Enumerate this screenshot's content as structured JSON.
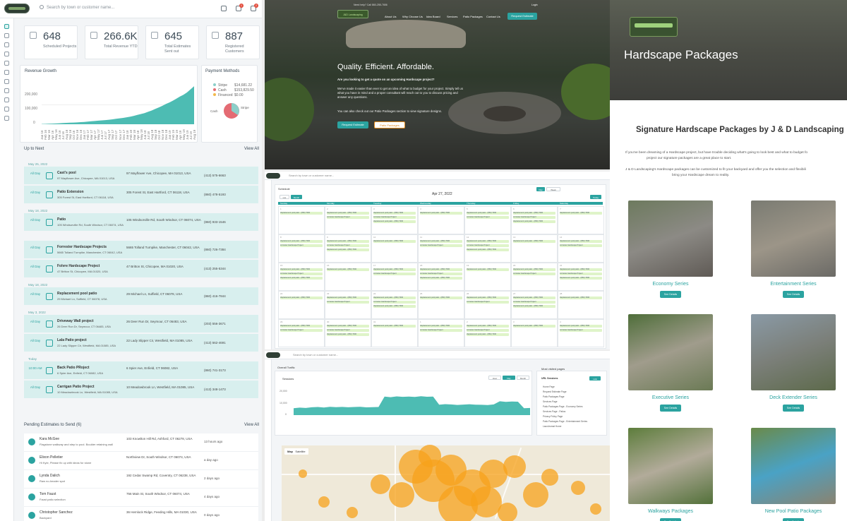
{
  "dash": {
    "search_placeholder": "Search by town or customer name...",
    "notif_count": "1",
    "msg_count": "2",
    "stats": [
      {
        "value": "648",
        "label": "Scheduled Projects"
      },
      {
        "value": "266.6K",
        "label": "Total Revenue YTD"
      },
      {
        "value": "645",
        "label": "Total Estimates Sent out"
      },
      {
        "value": "887",
        "label": "Registered Customers"
      }
    ],
    "revenue": {
      "title": "Revenue Growth",
      "y_ticks": [
        "200,000",
        "100,000",
        "0"
      ]
    },
    "payments": {
      "title": "Payment Methods",
      "items": [
        {
          "name": "Stripe",
          "amount": "$14,681.22",
          "color": "#8ccfc9"
        },
        {
          "name": "Cash",
          "amount": "$153,829.50",
          "color": "#e46b73"
        },
        {
          "name": "Financed",
          "amount": "$0.00",
          "color": "#f2b84b"
        }
      ],
      "label_cash": "Cash",
      "label_stripe": "Stripe"
    },
    "up_next": {
      "title": "Up to Next",
      "view_all": "View All",
      "groups": [
        {
          "date": "May 25, 2022",
          "rows": [
            {
              "time": "All Day",
              "name": "Cast's pool",
              "addr": "97 Mayflower Ave, Chicopee, MA 01013, USA",
              "addr2": "97 Mayflower Ave, Chicopee, MA 01013, USA",
              "phone": "(413) 575-6663"
            },
            {
              "time": "All Day",
              "name": "Patio Extension",
              "addr": "305 Forest St, East Hartford, CT 06118, USA",
              "addr2": "305 Forest St, East Hartford, CT 06118, USA",
              "phone": "(860) 478-5193"
            }
          ]
        },
        {
          "date": "May 18, 2022",
          "rows": [
            {
              "time": "All Day",
              "name": "Patio",
              "addr": "105 Windsorville Rd, South Windsor, CT 06074, USA",
              "addr2": "105 Windsorville Rd, South Windsor, CT 06074, USA",
              "phone": "(860) 933-1546"
            }
          ]
        },
        {
          "date": "",
          "rows": [
            {
              "time": "All Day",
              "name": "Forrester Hardscape Projects",
              "addr": "5665 Tolland Turnpike, Manchester, CT 06042, USA",
              "addr2": "5665 Tolland Turnpike, Manchester, CT 06042, USA",
              "phone": "(860) 726-7384"
            },
            {
              "time": "All Day",
              "name": "Folvre Hardscape Project",
              "addr": "47 Britton St, Chicopee, MA 01020, USA",
              "addr2": "47 Britton St, Chicopee, MA 01020, USA",
              "phone": "(413) 255-5344"
            }
          ]
        },
        {
          "date": "May 18, 2022",
          "rows": [
            {
              "time": "All Day",
              "name": "Replacement pool patio",
              "addr": "29 Michael Ln, Suffield, CT 06078, USA",
              "addr2": "29 Michael Ln, Suffield, CT 06078, USA",
              "phone": "(860) 416-7844"
            }
          ]
        },
        {
          "date": "May 3, 2022",
          "rows": [
            {
              "time": "All Day",
              "name": "Driveway Wall project",
              "addr": "26 Deer Run Dr, Seymour, CT 06483, USA",
              "addr2": "26 Deer Run Dr, Seymour, CT 06483, USA",
              "phone": "(203) 556-3671"
            },
            {
              "time": "All Day",
              "name": "Lala Patio project",
              "addr": "22 Lady Slipper Cir, Westfield, MA 01085, USA",
              "addr2": "22 Lady Slipper Cir, Westfield, MA 01085, USA",
              "phone": "(413) 562-4691"
            }
          ]
        },
        {
          "date": "Today",
          "rows": [
            {
              "time": "10:00 AM",
              "name": "Back Patio PRoject",
              "addr": "6 Spier Ave, Enfield, CT 06082, USA",
              "addr2": "6 Spier Ave, Enfield, CT 06082, USA",
              "phone": "(860) 741-3173"
            },
            {
              "time": "All Day",
              "name": "Carrigan Patio Project",
              "addr": "10 Meadowbrook Ln, Westfield, MA 01085, USA",
              "addr2": "10 Meadowbrook Ln, Westfield, MA 01085, USA",
              "phone": "(413) 348-1473"
            }
          ]
        }
      ]
    },
    "pending": {
      "title": "Pending Estimates to Send (6)",
      "view_all": "View All",
      "rows": [
        {
          "name": "Kara McGee",
          "comment": "Flagstone walkway and step to pool. Boulder retaining wall",
          "addr": "103 Knowlton Hill Rd, Ashford, CT 06278, USA",
          "ago": "13 hours ago"
        },
        {
          "name": "Elixon Pelletier",
          "comment": "Hi Kyle, Please fix up with ideas for stone",
          "addr": "Northview Dr, South Windsor, CT 06074, USA",
          "ago": "a day ago"
        },
        {
          "name": "Lynda Dalich",
          "comment": "Raw no-header spot",
          "addr": "192 Cedar Swamp Rd, Coventry, CT 06238, USA",
          "ago": "2 days ago"
        },
        {
          "name": "Tom Faust",
          "comment": "Faust patio selection",
          "addr": "756 Main St, South Windsor, CT 06074, USA",
          "ago": "4 days ago"
        },
        {
          "name": "Christopher Sanchez",
          "comment": "Backyard",
          "addr": "36 Hemlock Ridge, Feeding Hills, MA 01030, USA",
          "ago": "0 days ago"
        }
      ]
    }
  },
  "revenue_chart": {
    "type": "area",
    "x": [
      "Jan 16",
      "Feb 16",
      "Mar 16",
      "Apr 16",
      "May 16",
      "Jun 16",
      "Jul 16",
      "Aug 16",
      "Sep 16",
      "Oct 16",
      "Nov 16",
      "Dec 16",
      "Jan 17",
      "Feb 17",
      "Mar 17",
      "Apr 17",
      "May 17",
      "Jun 17",
      "Jul 17",
      "Aug 17",
      "Sep 17",
      "Oct 17",
      "Nov 17",
      "Dec 17",
      "Jan 18",
      "Feb 18",
      "Mar 18",
      "Apr 18",
      "May 18",
      "Jun 18",
      "Jul 18",
      "Aug 18",
      "Sep 18",
      "Oct 18",
      "Nov 18",
      "Dec 18",
      "Jan 19",
      "Feb 19",
      "Mar 19",
      "Apr 19",
      "May 19",
      "Jun 19",
      "Jul 19",
      "Aug 19"
    ],
    "values": [
      2000,
      2200,
      3000,
      4000,
      5000,
      6500,
      8000,
      9000,
      10000,
      11000,
      12000,
      13500,
      15000,
      17000,
      19000,
      21000,
      23000,
      25000,
      27000,
      29000,
      32000,
      35000,
      38000,
      41000,
      45000,
      49000,
      54000,
      60000,
      66000,
      72000,
      80000,
      88000,
      98000,
      108000,
      118000,
      130000,
      140000,
      152000,
      165000,
      178000,
      190000,
      205000,
      225000,
      245000
    ],
    "ylim": [
      0,
      250000
    ],
    "color": "#4dbcb3"
  },
  "site": {
    "top_line": "Need help? Call 860-255-7656",
    "logo_text": "J&D Landscaping",
    "nav": [
      "About Us",
      "Why Choose Us",
      "Idea Board",
      "Services",
      "Patio Packages",
      "Contact Us"
    ],
    "nav_button": "Request Estimate",
    "login": "Login",
    "hero_title": "Quality. Efficient. Affordable.",
    "hero_p1": "Are you looking to get a quote on an upcoming Hardscape project?",
    "hero_p2": "We've made it easier than ever to get an idea of what to budget for your project. Simply tell us what you have in mind and a proper consultant will reach out to you to discuss pricing and answer any questions.",
    "hero_p3": "You can also check out our Patio Packages section to view signature designs.",
    "btn1": "Request Estimate",
    "btn2": "Patio Packages"
  },
  "schedule": {
    "title": "Schedule",
    "date": "Apr 27, 2022",
    "toggles": [
      "List",
      "Month",
      "Day",
      "Week"
    ],
    "today": "Today",
    "search_placeholder": "Search by town or customer name...",
    "days": [
      "Sunday",
      "Monday",
      "Tuesday",
      "Wednesday",
      "Thursday",
      "Friday",
      "Saturday"
    ],
    "event_label": "Replacement pool patio - (860) 7000",
    "event_short": "Forrester Hardscape Project",
    "legend": [
      "Pending",
      "Accepted",
      "Expired",
      "Declined",
      "Done"
    ]
  },
  "traffic": {
    "title": "Overall Traffic",
    "sessions": "Sessions",
    "toggles": [
      "Hour",
      "Day",
      "Month"
    ],
    "y_ticks": [
      "20,000",
      "10,000",
      "0"
    ],
    "most_title": "Most visited pages",
    "col1": "URL",
    "col2": "Sessions",
    "col2b": "Link",
    "pages": [
      "Home Page",
      "Request Estimate Page",
      "Patio Packages Page",
      "Services Page",
      "Patio Packages Page - Economy Series",
      "Services Page - Patios",
      "Privacy Policy Page",
      "Patio Packages Page - Entertainment Series",
      "Laundromat Home"
    ],
    "map_tabs": [
      "Map",
      "Satellite"
    ]
  },
  "traffic_chart": {
    "type": "area",
    "values": [
      6000,
      6500,
      6200,
      6800,
      7000,
      6600,
      7200,
      6900,
      7100,
      6800,
      7000,
      7200,
      6700,
      6900,
      7000,
      16000,
      15500,
      16200,
      15800,
      16000,
      15700,
      16300,
      15900,
      16100,
      9000,
      9500,
      9200,
      8800,
      9100,
      9400,
      9000,
      8900,
      8700,
      9200,
      12000,
      11500,
      11800,
      11600,
      6000,
      6200
    ],
    "ylim": [
      0,
      22000
    ],
    "color": "#4dbcb3"
  },
  "packages": {
    "header": "Hardscape Packages",
    "heading": "Signature Hardscape Packages by J & D Landscaping",
    "p1a": "If you've been dreaming of a Hardscape project, but have trouble deciding what's going to look best and what to budget fo",
    "p1b": "project our signature packages are a great place to start.",
    "p2a": "J & D Landscaping's Hardscape packages can be customized to fit your backyard and offer you the selection and flexibili",
    "p2b": "bring your Hardscape dream to reality.",
    "see": "See Details",
    "items": [
      "Economy Series",
      "Entertainment Series",
      "Executive Series",
      "Deck Extender Series",
      "Walkways Packages",
      "New Pool Patio Packages"
    ]
  }
}
